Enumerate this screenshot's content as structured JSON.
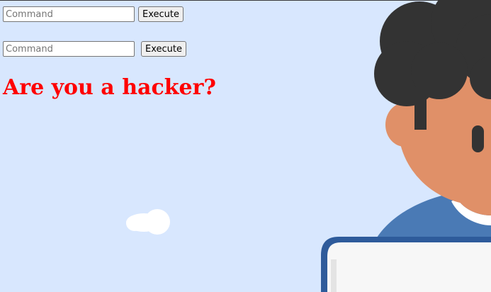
{
  "form_primary": {
    "input_placeholder": "Command",
    "input_value": "",
    "button_label": "Execute"
  },
  "form_secondary": {
    "input_placeholder": "Command",
    "input_value": "",
    "button_label": "Execute"
  },
  "headline": "Are you a hacker?",
  "illustration": {
    "icon": "person-at-laptop-illustration",
    "colors": {
      "background": "#d8e7fe",
      "hair": "#333333",
      "skin": "#e09068",
      "shirt": "#4a7ab5",
      "laptop_frame": "#2e5b9b",
      "laptop_screen": "#f7f7f7",
      "cloud": "#ffffff"
    }
  },
  "accent_color": "#ff0000"
}
